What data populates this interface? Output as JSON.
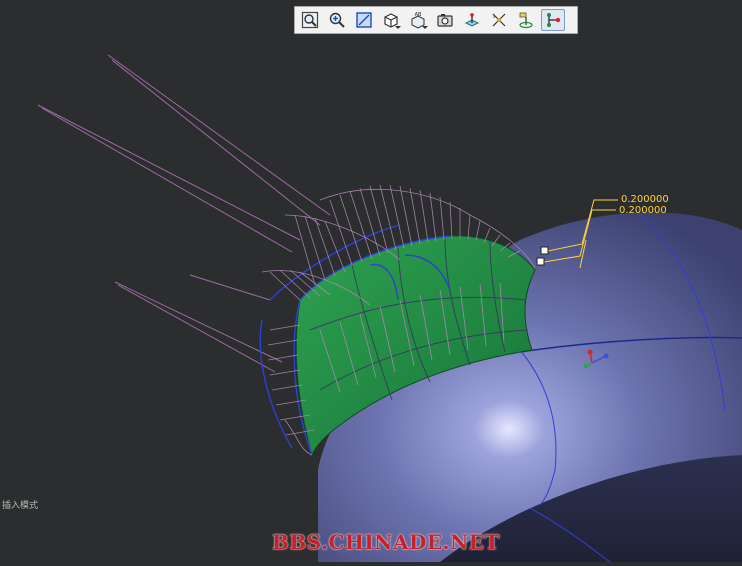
{
  "toolbar": {
    "buttons": [
      {
        "name": "zoom-fit-button",
        "icon": "zoom-fit-icon",
        "has_dropdown": false
      },
      {
        "name": "zoom-in-button",
        "icon": "zoom-in-icon",
        "has_dropdown": false
      },
      {
        "name": "zoom-window-button",
        "icon": "zoom-window-icon",
        "has_dropdown": false
      },
      {
        "name": "display-style-button",
        "icon": "display-style-icon",
        "has_dropdown": true
      },
      {
        "name": "named-view-button",
        "icon": "named-view-icon",
        "has_dropdown": true
      },
      {
        "name": "saved-views-button",
        "icon": "saved-views-icon",
        "has_dropdown": false
      },
      {
        "name": "datum-display-button",
        "icon": "datum-display-icon",
        "has_dropdown": false
      },
      {
        "name": "annotation-display-button",
        "icon": "annotation-display-icon",
        "has_dropdown": false
      },
      {
        "name": "spin-center-button",
        "icon": "spin-center-icon",
        "has_dropdown": false
      },
      {
        "name": "branch-connect-button",
        "icon": "branch-connect-icon",
        "has_dropdown": false,
        "active": true
      }
    ]
  },
  "dimensions": {
    "value_1": "0.200000",
    "value_2": "0.200000"
  },
  "status": {
    "mode_text": "插入模式"
  },
  "watermark": {
    "text": "BBS.CHINADE.NET"
  },
  "colors": {
    "background": "#2b2d2e",
    "surface": "#6a70ac",
    "patch_green": "#1f8a3c",
    "boundary_blue": "#2f3fd8",
    "curvature_magenta": "#a06aa6",
    "dimension_yellow": "#ffd23a",
    "watermark_red": "#c8202a"
  }
}
